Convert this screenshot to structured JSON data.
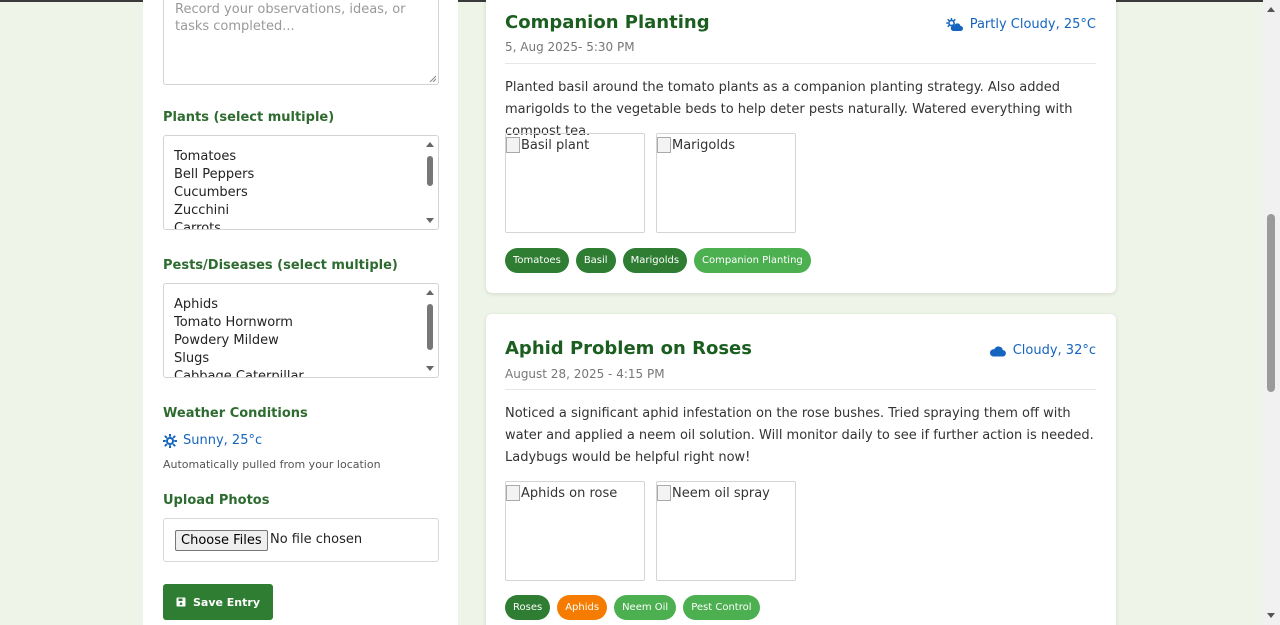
{
  "form": {
    "notes_placeholder": "Record your observations, ideas, or tasks completed...",
    "plants_label": "Plants (select multiple)",
    "plants_options": [
      "Tomatoes",
      "Bell Peppers",
      "Cucumbers",
      "Zucchini",
      "Carrots"
    ],
    "pests_label": "Pests/Diseases (select multiple)",
    "pests_options": [
      "Aphids",
      "Tomato Hornworm",
      "Powdery Mildew",
      "Slugs",
      "Cabbage Caterpillar"
    ],
    "weather_label": "Weather Conditions",
    "weather_value": "Sunny, 25°c",
    "weather_helper": "Automatically pulled from your location",
    "upload_label": "Upload Photos",
    "choose_files": "Choose Files",
    "no_file": "No file chosen",
    "save_label": "Save Entry"
  },
  "entries": [
    {
      "title": "Companion Planting",
      "date": "5, Aug 2025- 5:30 PM",
      "weather": "Partly Cloudy, 25°C",
      "weather_icon": "cloud-sun-icon",
      "body": "Planted basil around the tomato plants as a companion planting strategy. Also added marigolds to the vegetable beds to help deter pests naturally. Watered everything with compost tea.",
      "photos": [
        "Basil plant",
        "Marigolds"
      ],
      "tags": [
        {
          "label": "Tomatoes",
          "color": "#2e7d32"
        },
        {
          "label": "Basil",
          "color": "#2e7d32"
        },
        {
          "label": "Marigolds",
          "color": "#2e7d32"
        },
        {
          "label": "Companion Planting",
          "color": "#4caf50"
        }
      ]
    },
    {
      "title": "Aphid Problem on Roses",
      "date": "August 28, 2025 - 4:15 PM",
      "weather": "Cloudy, 32°c",
      "weather_icon": "cloud-icon",
      "body": "Noticed a significant aphid infestation on the rose bushes. Tried spraying them off with water and applied a neem oil solution. Will monitor daily to see if further action is needed. Ladybugs would be helpful right now!",
      "photos": [
        "Aphids on rose",
        "Neem oil spray"
      ],
      "tags": [
        {
          "label": "Roses",
          "color": "#2e7d32"
        },
        {
          "label": "Aphids",
          "color": "#f57c00"
        },
        {
          "label": "Neem Oil",
          "color": "#4caf50"
        },
        {
          "label": "Pest Control",
          "color": "#4caf50"
        }
      ]
    }
  ],
  "colors": {
    "background": "#eef5e8",
    "primary_green": "#2e7d32",
    "title_green": "#1b5e20",
    "weather_blue": "#1565c0",
    "warning_orange": "#f57c00",
    "light_green": "#4caf50"
  }
}
